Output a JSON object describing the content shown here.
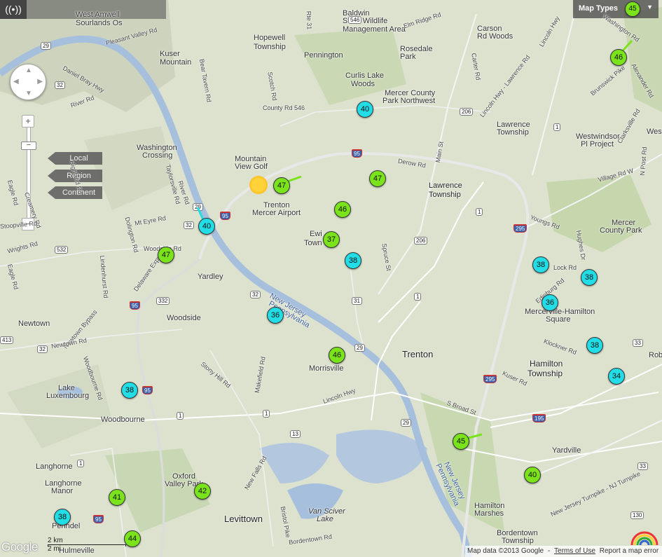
{
  "toolbar": {
    "signal_icon": "wifi-signal-icon",
    "map_types_label": "Map Types",
    "map_types_marker": "45",
    "map_types_caret": "▼"
  },
  "zoom": {
    "plus": "+",
    "minus": "−",
    "levels": [
      "Local",
      "Region",
      "Continent"
    ]
  },
  "places": {
    "west_amwell": "West Amwell",
    "sourlands": "Sourlands Os",
    "kuser": "Kuser",
    "kuser2": "Mountain",
    "hopewell": "Hopewell",
    "hopewell2": "Township",
    "pennington": "Pennington",
    "baldwin1": "Baldwin",
    "baldwin2": "State Wildlife",
    "baldwin3": "Management Area",
    "carson1": "Carson",
    "carson2": "Rd Woods",
    "rosedale1": "Rosedale",
    "rosedale2": "Park",
    "curlis1": "Curlis Lake",
    "curlis2": "Woods",
    "mercerpark1": "Mercer County",
    "mercerpark2": "Park Northwest",
    "washington1": "Washington",
    "washington2": "Crossing",
    "mountainview1": "Mountain",
    "mountainview2": "View Golf",
    "trentonairport1": "Trenton",
    "trentonairport2": "Mercer Airport",
    "lawrenceville1": "Lawrence",
    "lawrenceville2": "Township",
    "lawrence_twp1": "Lawrence",
    "lawrence_twp2": "Township",
    "westwindsor1": "Westwindsor",
    "westwindsor2": "Pl Project",
    "west": "West",
    "mercercp1": "Mercer",
    "mercercp2": "County Park",
    "ewing1": "Ewi",
    "ewing2": "Town",
    "yardley": "Yardley",
    "woodside": "Woodside",
    "newtown": "Newtown",
    "trenton": "Trenton",
    "mercerville1": "Mercerville-Hamilton",
    "mercerville2": "Square",
    "hamilton1": "Hamilton",
    "hamilton2": "Township",
    "morrisville": "Morrisville",
    "lake_lux1": "Lake",
    "lake_lux2": "Luxembourg",
    "woodbourne": "Woodbourne",
    "langhorne": "Langhorne",
    "langhorne_manor1": "Langhorne",
    "langhorne_manor2": "Manor",
    "oxford1": "Oxford",
    "oxford2": "Valley Park",
    "levittown": "Levittown",
    "vansciver1": "Van Sciver",
    "vansciver2": "Lake",
    "hamilton_marsh1": "Hamilton",
    "hamilton_marsh2": "Marshes",
    "yardville": "Yardville",
    "bordentown1": "Bordentown",
    "bordentown2": "Township",
    "penndel": "Penndel",
    "hulmeville": "Hulmeville",
    "robb": "Rob",
    "river_nj": "New Jersey",
    "river_pa": "Pennsylvania",
    "river_nj2": "New Jersey",
    "river_pa2": "Pennsylvania"
  },
  "roads": {
    "pleasant_valley": "Pleasant Valley Rd",
    "daniel_bray": "Daniel Bray Hwy",
    "river_rd": "River Rd",
    "bear_tavern": "Bear Tavern Rd",
    "scotch": "Scotch Rd",
    "county546": "County Rd 546",
    "elm_ridge": "Elm Ridge Rd",
    "rte31": "Rte 31",
    "carter": "Carter Rd",
    "lincoln_hwy_n": "Lincoln Hwy - Lawrence Rd",
    "lincoln_hwy2": "Lincoln Hwy",
    "washington_rd": "Washington Rd",
    "brunswick": "Brunswick Pike",
    "alexander": "Alexander Rd",
    "clarksville": "Clarksville Rd",
    "n_post": "N Post Rd",
    "village": "Village Rd W",
    "derow": "Derow Rd",
    "main_st": "Main St",
    "youngs": "Youngs Rd",
    "hughes": "Hughes Dr",
    "taylorsville": "Taylorsville Rd",
    "river_rd2": "River Rd",
    "dolington": "Dolington Rd",
    "mt_eyre": "Mt Eyre Rd",
    "woodside_rd": "Woodside Rd",
    "lindenhurst": "Lindenhurst Rd",
    "delaware_expy": "Delaware Expy",
    "newtown_bypass": "Newtown Bypass",
    "newtown_rd": "Newtown Rd",
    "woodbourne_rd": "Woodbourne Rd",
    "stony_hill": "Stony Hill Rd",
    "makefield": "Makefield Rd",
    "lincoln_hwy": "Lincoln Hwy",
    "edinburg": "Edinburg Rd",
    "klockner": "Klockner Rd",
    "kuser_rd": "Kuser Rd",
    "s_broad": "S Broad St",
    "spruce": "Spruce St",
    "new_falls": "New Falls Rd",
    "bristol": "Bristol Pike",
    "bordentown_rd": "Bordentown Rd",
    "nj_turnpike": "New Jersey Turnpike - NJ Turnpike",
    "cremey": "Creamery Rd",
    "wrights": "Wrights Rd",
    "eagle": "Eagle Rd",
    "highland": "Highland Rd",
    "stoopville": "Stoopville Rd",
    "lock": "Lock Rd",
    "eagle2": "Eagle Rd"
  },
  "shields": {
    "s29a": "29",
    "s32a": "32",
    "s546": "546",
    "s95a": "95",
    "s206a": "206",
    "s1a": "1",
    "s29b": "29",
    "s32b": "32",
    "s95b": "95",
    "s1b": "1",
    "s206b": "206",
    "s295a": "295",
    "s532": "532",
    "s332": "332",
    "s95c": "95",
    "s32c": "32",
    "s31": "31",
    "s1c": "1",
    "s33": "33",
    "s29c": "29",
    "s413": "413",
    "s32d": "32",
    "s95d": "95",
    "s295b": "295",
    "s195": "195",
    "s1d": "1",
    "s1e": "1",
    "s13": "13",
    "s1f": "1",
    "s95e": "95",
    "s29d": "29",
    "s130": "130",
    "s33b": "33"
  },
  "markers": [
    {
      "v": "46",
      "c": "green"
    },
    {
      "v": "40",
      "c": "cyan"
    },
    {
      "v": "47",
      "c": "green"
    },
    {
      "v": "47",
      "c": "green"
    },
    {
      "v": "46",
      "c": "green"
    },
    {
      "v": "40",
      "c": "cyan"
    },
    {
      "v": "37",
      "c": "green"
    },
    {
      "v": "47",
      "c": "green"
    },
    {
      "v": "38",
      "c": "cyan"
    },
    {
      "v": "36",
      "c": "cyan"
    },
    {
      "v": "38",
      "c": "cyan"
    },
    {
      "v": "38",
      "c": "cyan"
    },
    {
      "v": "36",
      "c": "cyan"
    },
    {
      "v": "46",
      "c": "green"
    },
    {
      "v": "38",
      "c": "cyan"
    },
    {
      "v": "34",
      "c": "cyan"
    },
    {
      "v": "38",
      "c": "cyan"
    },
    {
      "v": "45",
      "c": "green"
    },
    {
      "v": "42",
      "c": "green"
    },
    {
      "v": "41",
      "c": "green"
    },
    {
      "v": "40",
      "c": "green"
    },
    {
      "v": "38",
      "c": "cyan"
    },
    {
      "v": "44",
      "c": "green"
    }
  ],
  "footer": {
    "logo": "Google",
    "scale_km": "2 km",
    "scale_mi": "2 mi",
    "map_data": "Map data ©2013 Google",
    "sep": "-",
    "terms": "Terms of Use",
    "report": "Report a map error"
  },
  "colors": {
    "cyan_marker": "#22dde6",
    "green_marker": "#7be31c",
    "river": "#a5bfdd",
    "highway": "#e8e8e8"
  }
}
